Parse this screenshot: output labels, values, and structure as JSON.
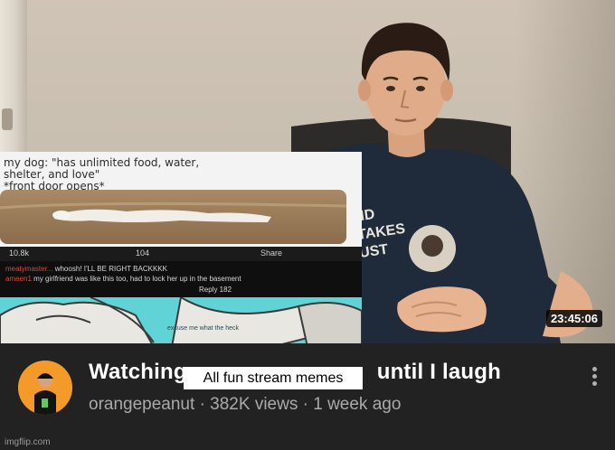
{
  "video": {
    "timestamp": "23:45:06"
  },
  "meme": {
    "text_lines": "my dog: \"has unlimited food, water,\nshelter, and love\"\n*front door opens*\nmy dog",
    "stats": {
      "upvotes": "10.8k",
      "comments": "104",
      "share": "Share"
    },
    "comments": [
      {
        "user": "meatymaster...",
        "text": "whoosh! I'LL BE RIGHT BACKKKK"
      },
      {
        "user": "ameen1",
        "text": "my girlfriend was like this too, had to lock her up in the basement"
      },
      {
        "user": "",
        "text": "Reply   182"
      }
    ],
    "bottom_caption": "excuse me what the heck"
  },
  "info": {
    "title_part1": "Watching",
    "title_part2": "until I laugh",
    "caption_overlay": "All fun stream memes",
    "channel": "orangepeanut",
    "views": "382K views",
    "age": "1 week ago",
    "separator": "·",
    "watermark": "imgflip.com"
  },
  "colors": {
    "background": "#222222",
    "avatar": "#f39a2b",
    "meme_accent": "#5fd3d6"
  },
  "icons": {
    "more": "more-vertical-icon",
    "avatar": "channel-avatar-icon"
  }
}
